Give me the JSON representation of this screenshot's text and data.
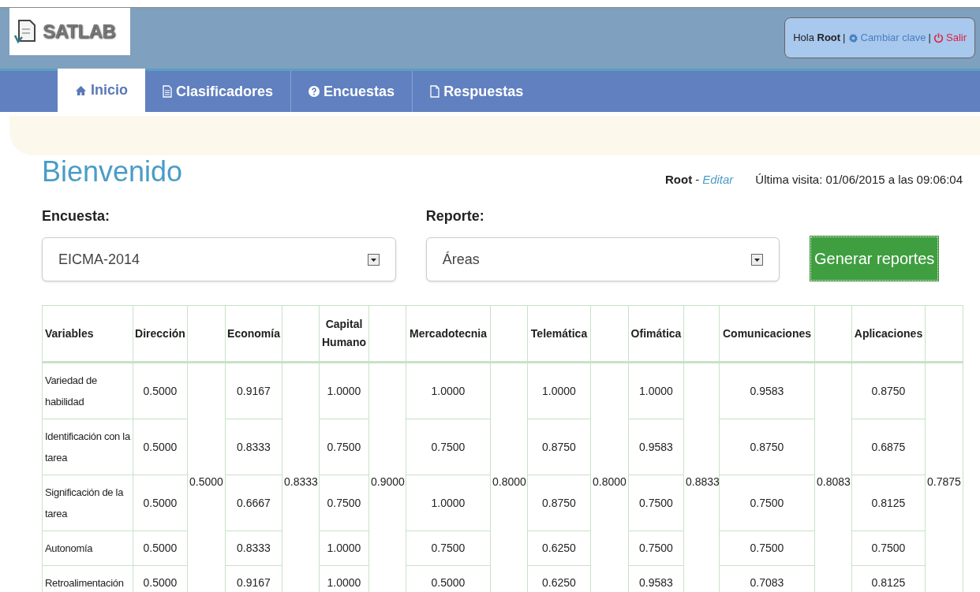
{
  "logo": {
    "text": "SATLAB"
  },
  "user_box": {
    "greeting": "Hola",
    "user": "Root",
    "separators": [
      "|",
      "|"
    ],
    "change_password": "Cambiar clave",
    "logout": "Salir"
  },
  "nav": [
    {
      "label": "Inicio",
      "selected": true
    },
    {
      "label": "Clasificadores",
      "selected": false
    },
    {
      "label": "Encuestas",
      "selected": false
    },
    {
      "label": "Respuestas",
      "selected": false
    }
  ],
  "page_title": "Bienvenido",
  "user_info": {
    "user": "Root",
    "separator": "-",
    "edit_link": "Editar",
    "last_visit": "Última visita: 01/06/2015 a las 09:06:04"
  },
  "form": {
    "survey": {
      "label": "Encuesta:",
      "value": "EICMA-2014"
    },
    "report": {
      "label": "Reporte:",
      "value": "Áreas"
    },
    "button": "Generar reportes"
  },
  "table": {
    "first_column": "Variables",
    "rows": [
      "Variedad de habilidad",
      "Identificación con la tarea",
      "Significación de la tarea",
      "Autonomía",
      "Retroalimentación"
    ],
    "areas": [
      {
        "name": "Dirección",
        "values": [
          "0.5000",
          "0.5000",
          "0.5000",
          "0.5000",
          "0.5000"
        ],
        "average": "0.5000"
      },
      {
        "name": "Economía",
        "values": [
          "0.9167",
          "0.8333",
          "0.6667",
          "0.8333",
          "0.9167"
        ],
        "average": "0.8333"
      },
      {
        "name": "Capital Humano",
        "values": [
          "1.0000",
          "0.7500",
          "0.7500",
          "1.0000",
          "1.0000"
        ],
        "average": "0.9000"
      },
      {
        "name": "Mercadotecnia",
        "values": [
          "1.0000",
          "0.7500",
          "1.0000",
          "0.7500",
          "0.5000"
        ],
        "average": "0.8000"
      },
      {
        "name": "Telemática",
        "values": [
          "1.0000",
          "0.8750",
          "0.8750",
          "0.6250",
          "0.6250"
        ],
        "average": "0.8000"
      },
      {
        "name": "Ofimática",
        "values": [
          "1.0000",
          "0.9583",
          "0.7500",
          "0.7500",
          "0.9583"
        ],
        "average": "0.8833"
      },
      {
        "name": "Comunicaciones",
        "values": [
          "0.9583",
          "0.8750",
          "0.7500",
          "0.7500",
          "0.7083"
        ],
        "average": "0.8083"
      },
      {
        "name": "Aplicaciones",
        "values": [
          "0.8750",
          "0.6875",
          "0.8125",
          "0.7500",
          "0.8125"
        ],
        "average": "0.7875"
      }
    ]
  }
}
